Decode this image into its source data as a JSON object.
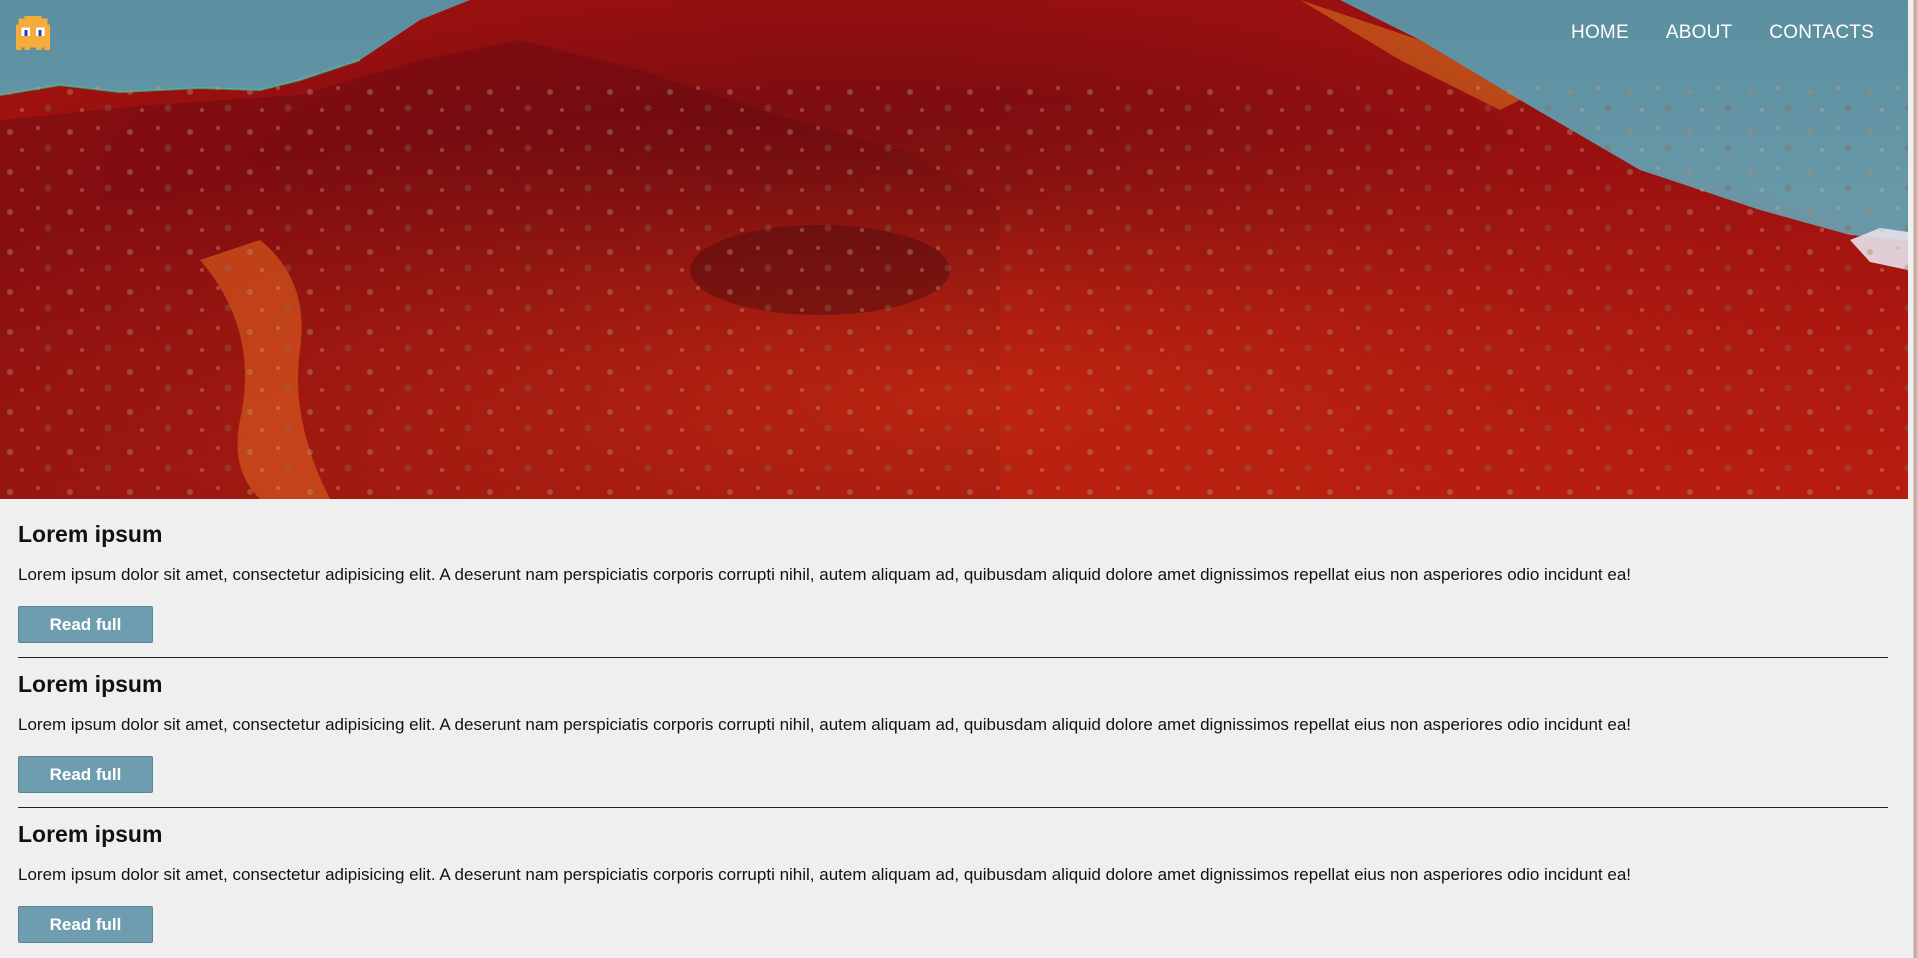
{
  "header": {
    "logo_icon": "pixel-ghost-icon",
    "nav": [
      {
        "label": "HOME"
      },
      {
        "label": "ABOUT"
      },
      {
        "label": "CONTACTS"
      }
    ]
  },
  "hero": {
    "image": "red-mountain-photo"
  },
  "articles": [
    {
      "title": "Lorem ipsum",
      "text": "Lorem ipsum dolor sit amet, consectetur adipisicing elit. A deserunt nam perspiciatis corporis corrupti nihil, autem aliquam ad, quibusdam aliquid dolore amet dignissimos repellat eius non asperiores odio incidunt ea!",
      "button": "Read full"
    },
    {
      "title": "Lorem ipsum",
      "text": "Lorem ipsum dolor sit amet, consectetur adipisicing elit. A deserunt nam perspiciatis corporis corrupti nihil, autem aliquam ad, quibusdam aliquid dolore amet dignissimos repellat eius non asperiores odio incidunt ea!",
      "button": "Read full"
    },
    {
      "title": "Lorem ipsum",
      "text": "Lorem ipsum dolor sit amet, consectetur adipisicing elit. A deserunt nam perspiciatis corporis corrupti nihil, autem aliquam ad, quibusdam aliquid dolore amet dignissimos repellat eius non asperiores odio incidunt ea!",
      "button": "Read full"
    }
  ],
  "colors": {
    "background": "#efefef",
    "button": "#6f9db0",
    "sky": "#6a9aaa",
    "mountain": "#9a0f10"
  }
}
